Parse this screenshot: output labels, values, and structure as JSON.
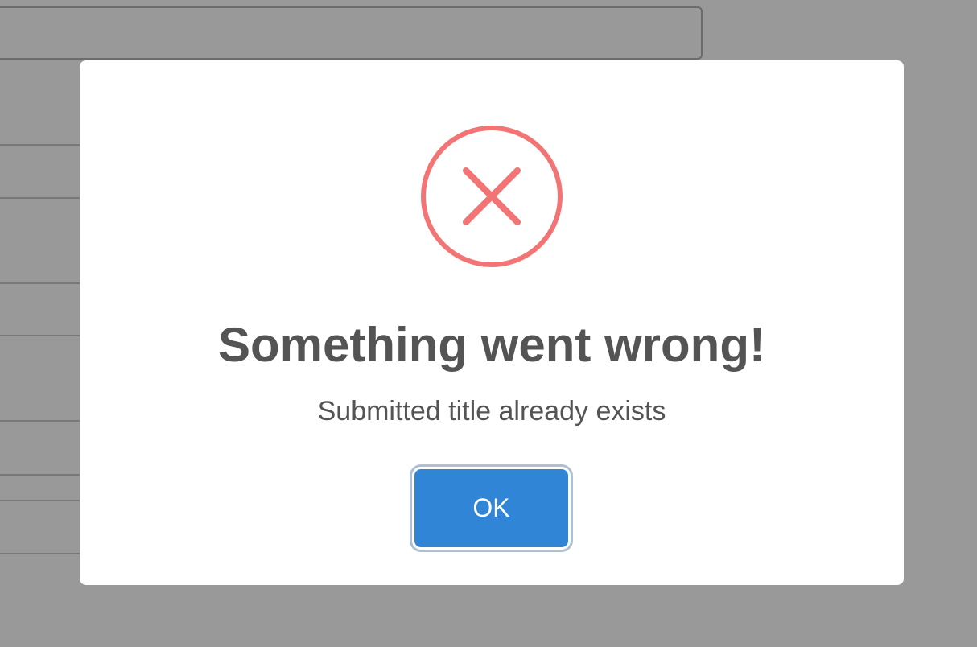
{
  "modal": {
    "icon": "error-x-circle-icon",
    "icon_color": "#f27474",
    "title": "Something went wrong!",
    "text": "Submitted title already exists",
    "confirm_button": {
      "label": "OK",
      "color": "#3085d6"
    }
  },
  "overlay_color": "rgba(0,0,0,0.4)"
}
